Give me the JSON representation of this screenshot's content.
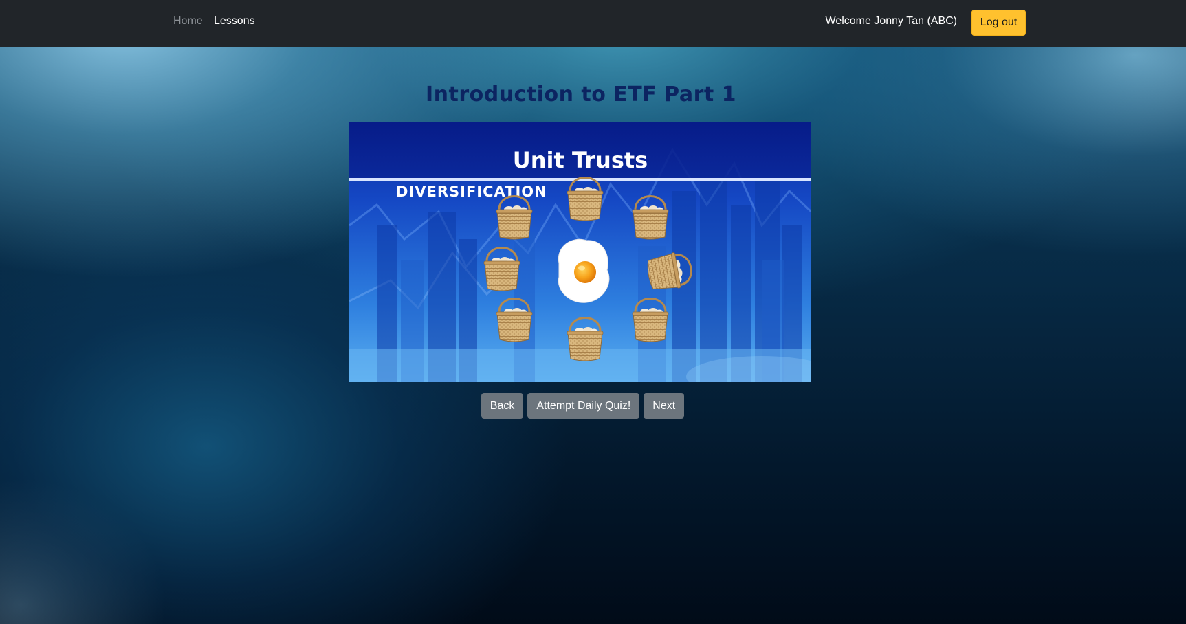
{
  "nav": {
    "home": "Home",
    "lessons": "Lessons",
    "welcome": "Welcome Jonny Tan (ABC)",
    "logout": "Log out"
  },
  "lesson": {
    "title": "Introduction to ETF Part 1",
    "slide": {
      "heading": "Unit Trusts",
      "subheading": "DIVERSIFICATION"
    }
  },
  "buttons": {
    "back": "Back",
    "quiz": "Attempt Daily Quiz!",
    "next": "Next"
  },
  "colors": {
    "navbar": "#212529",
    "accent_button": "#ffc12e",
    "title": "#0c2461",
    "secondary_button": "#6c757d"
  }
}
